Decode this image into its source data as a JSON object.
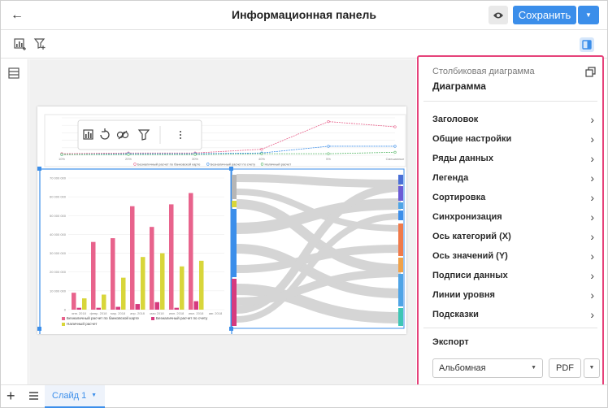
{
  "header": {
    "title": "Информационная панель",
    "save_label": "Сохранить"
  },
  "panel": {
    "subtitle": "Столбиковая диаграмма",
    "title": "Диаграмма",
    "items": [
      "Заголовок",
      "Общие настройки",
      "Ряды данных",
      "Легенда",
      "Сортировка",
      "Синхронизация",
      "Ось категорий (X)",
      "Ось значений (Y)",
      "Подписи данных",
      "Линии уровня",
      "Подсказки"
    ],
    "export_label": "Экспорт",
    "orientation_value": "Альбомная",
    "format_label": "PDF"
  },
  "bottom": {
    "slide_tab": "Слайд 1"
  },
  "colors": {
    "accent": "#3b8eea",
    "panel_border": "#e6427a",
    "series_card_bank": "#e8638c",
    "series_account": "#d63a7e",
    "series_cash": "#d8d63a"
  },
  "chart_data": [
    {
      "type": "line",
      "x": [
        "10%",
        "20%",
        "30%",
        "40%",
        "5%",
        "Смешанные"
      ],
      "series": [
        {
          "name": "Безналичный расчет по банковской карте",
          "values": [
            2,
            3,
            3,
            8,
            45,
            38
          ]
        },
        {
          "name": "Безналичный расчет по счету",
          "values": [
            1,
            2,
            2,
            3,
            12,
            12
          ]
        },
        {
          "name": "Наличный расчет",
          "values": [
            1,
            1,
            1,
            2,
            2,
            4
          ]
        }
      ]
    },
    {
      "type": "bar",
      "categories": [
        "янв. 2018",
        "февр. 2018",
        "мар. 2018",
        "апр. 2018",
        "мая 2018",
        "июн. 2018",
        "июл. 2018",
        "авг. 2018"
      ],
      "ylim": [
        0,
        70000000
      ],
      "series": [
        {
          "name": "Безналичный расчет по банковской карте",
          "values": [
            9000000,
            36000000,
            38000000,
            55000000,
            44000000,
            56000000,
            62000000,
            0
          ]
        },
        {
          "name": "Безналичный расчет по счету",
          "values": [
            1000000,
            1000000,
            1500000,
            3000000,
            4000000,
            1000000,
            4500000,
            0
          ]
        },
        {
          "name": "Наличный расчет",
          "values": [
            6000000,
            8000000,
            17000000,
            28000000,
            30000000,
            23000000,
            26000000,
            0
          ]
        }
      ],
      "y_ticks": [
        "70 000 000",
        "60 000 000",
        "50 000 000",
        "40 000 000",
        "30 000 000",
        "20 000 000",
        "10 000 000",
        "0"
      ]
    }
  ]
}
